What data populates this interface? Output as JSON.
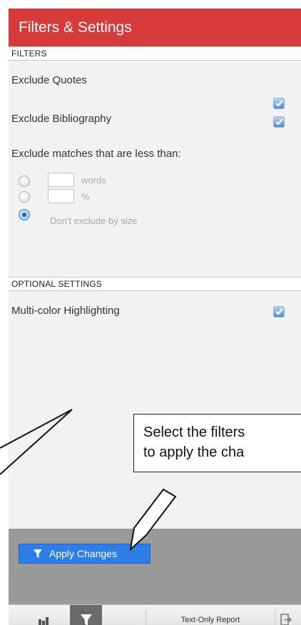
{
  "header": {
    "title": "Filters & Settings"
  },
  "filters": {
    "section_label": "FILTERS",
    "exclude_quotes": {
      "label": "Exclude Quotes",
      "checked": true
    },
    "exclude_bibliography": {
      "label": "Exclude Bibliography",
      "checked": true
    },
    "exclude_matches_label": "Exclude matches that are less than:",
    "size_options": [
      {
        "unit_label": "words",
        "value": "",
        "selected": false
      },
      {
        "unit_label": "%",
        "value": "",
        "selected": false
      },
      {
        "label": "Don't exclude by size",
        "selected": true
      }
    ]
  },
  "optional": {
    "section_label": "OPTIONAL SETTINGS",
    "multi_color": {
      "label": "Multi-color Highlighting",
      "checked": true
    }
  },
  "callout": {
    "line1": "Select the filters",
    "line2": "to apply the cha"
  },
  "apply_button": {
    "label": "Apply Changes"
  },
  "toolbar": {
    "text_only_report": "Text-Only Report"
  },
  "colors": {
    "header": "#d63a3a",
    "apply_button": "#2f7ee8",
    "footer_gray": "#9a9a9a"
  },
  "icons": [
    "bar-chart-icon",
    "filter-icon",
    "export-icon",
    "checkmark-icon"
  ]
}
